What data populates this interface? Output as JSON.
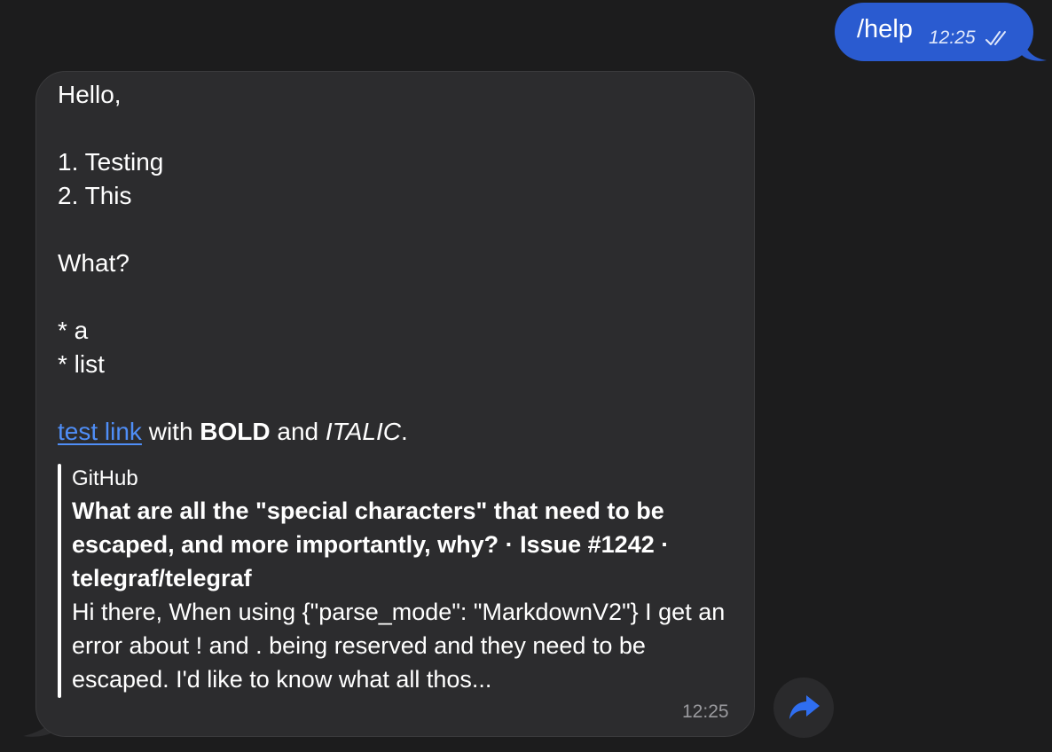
{
  "outgoing": {
    "text": "/help",
    "time": "12:25",
    "status_icon": "double-check-icon",
    "colors": {
      "bubble": "#2a5bd0"
    }
  },
  "incoming": {
    "greeting": "Hello,",
    "numbered_items": [
      "1. Testing",
      "2. This"
    ],
    "question": "What?",
    "bullet_items": [
      "* a",
      "* list"
    ],
    "link_line": {
      "link_text": "test link",
      "text_with": " with ",
      "bold_text": "BOLD",
      "text_and": " and ",
      "italic_text": "ITALIC",
      "text_end": "."
    },
    "preview": {
      "site_name": "GitHub",
      "title": "What are all the \"special characters\" that need to be escaped, and more importantly, why? · Issue #1242 · telegraf/telegraf",
      "description": "Hi there, When using {\"parse_mode\": \"MarkdownV2\"} I get an error about ! and . being reserved and they need to be escaped. I'd like to know what all thos..."
    },
    "time": "12:25",
    "colors": {
      "bubble": "#2c2c2e",
      "link": "#4f8ef7"
    }
  },
  "share_button": {
    "icon": "share-arrow-icon",
    "color": "#2f6ef0"
  }
}
